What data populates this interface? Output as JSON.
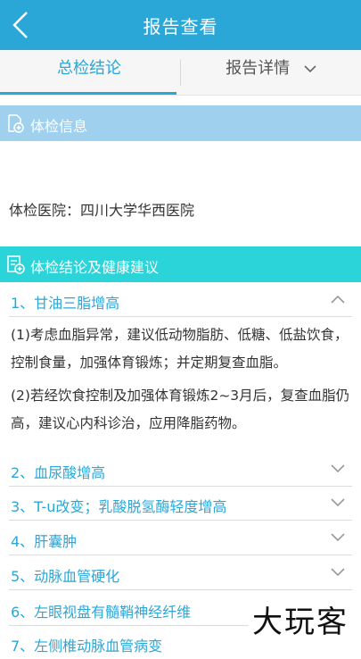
{
  "header": {
    "title": "报告查看",
    "back_icon": "chevron-left-icon"
  },
  "tabs": [
    {
      "label": "总检结论",
      "active": true
    },
    {
      "label": "报告详情",
      "active": false
    }
  ],
  "exam_info": {
    "section_title": "体检信息",
    "hospital_line": "体检医院：四川大学华西医院"
  },
  "conclusions": {
    "section_title": "体检结论及健康建议",
    "items": [
      {
        "label": "1、甘油三脂增高",
        "expanded": true
      },
      {
        "label": "2、血尿酸增高",
        "expanded": false
      },
      {
        "label": "3、T-u改变；乳酸脱氢酶轻度增高",
        "expanded": false
      },
      {
        "label": "4、肝囊肿",
        "expanded": false
      },
      {
        "label": "5、动脉血管硬化",
        "expanded": false
      },
      {
        "label": "6、左眼视盘有髓鞘神经纤维",
        "expanded": false
      },
      {
        "label": "7、左侧椎动脉血管病变",
        "expanded": false
      }
    ],
    "advice": [
      "(1)考虑血脂异常，建议低动物脂肪、低糖、低盐饮食，控制食量，加强体育锻炼；并定期复查血脂。",
      "(2)若经饮食控制及加强体育锻炼2~3月后，复查血脂仍高，建议心内科诊治，应用降脂药物。"
    ]
  },
  "watermark": "大玩客",
  "colors": {
    "primary": "#2aa7d7",
    "section_light": "#9fd1ee",
    "section_cyan": "#2ad4d9"
  }
}
